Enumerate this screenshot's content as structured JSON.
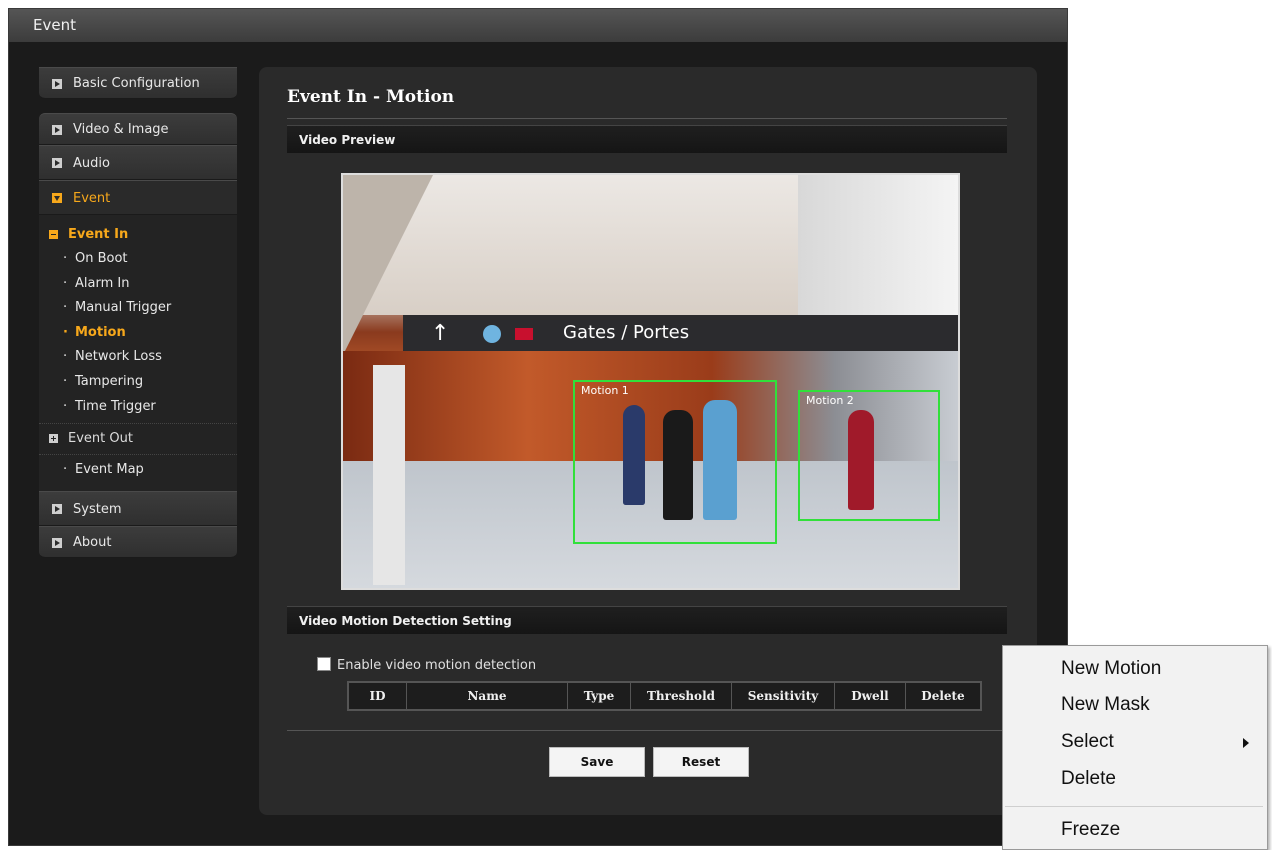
{
  "window": {
    "title": "Event"
  },
  "sidebar": {
    "basic_configuration": "Basic Configuration",
    "video_image": "Video & Image",
    "audio": "Audio",
    "event": "Event",
    "event_in": "Event In",
    "event_in_items": [
      "On Boot",
      "Alarm In",
      "Manual Trigger",
      "Motion",
      "Network Loss",
      "Tampering",
      "Time Trigger"
    ],
    "event_out": "Event Out",
    "event_map": "Event Map",
    "system": "System",
    "about": "About"
  },
  "main": {
    "title": "Event In - Motion",
    "video_preview_header": "Video Preview",
    "video": {
      "sign_text": "Gates / Portes",
      "motion_labels": [
        "Motion 1",
        "Motion 2"
      ]
    },
    "detection_header": "Video Motion Detection Setting",
    "enable_label": "Enable video motion detection",
    "enable_checked": false,
    "table_headers": [
      "ID",
      "Name",
      "Type",
      "Threshold",
      "Sensitivity",
      "Dwell",
      "Delete"
    ],
    "save_label": "Save",
    "reset_label": "Reset"
  },
  "context_menu": {
    "items": [
      "New Motion",
      "New Mask",
      "Select",
      "Delete",
      "Freeze"
    ]
  },
  "colors": {
    "accent": "#f7a81b",
    "motion_box": "#31e03a"
  }
}
